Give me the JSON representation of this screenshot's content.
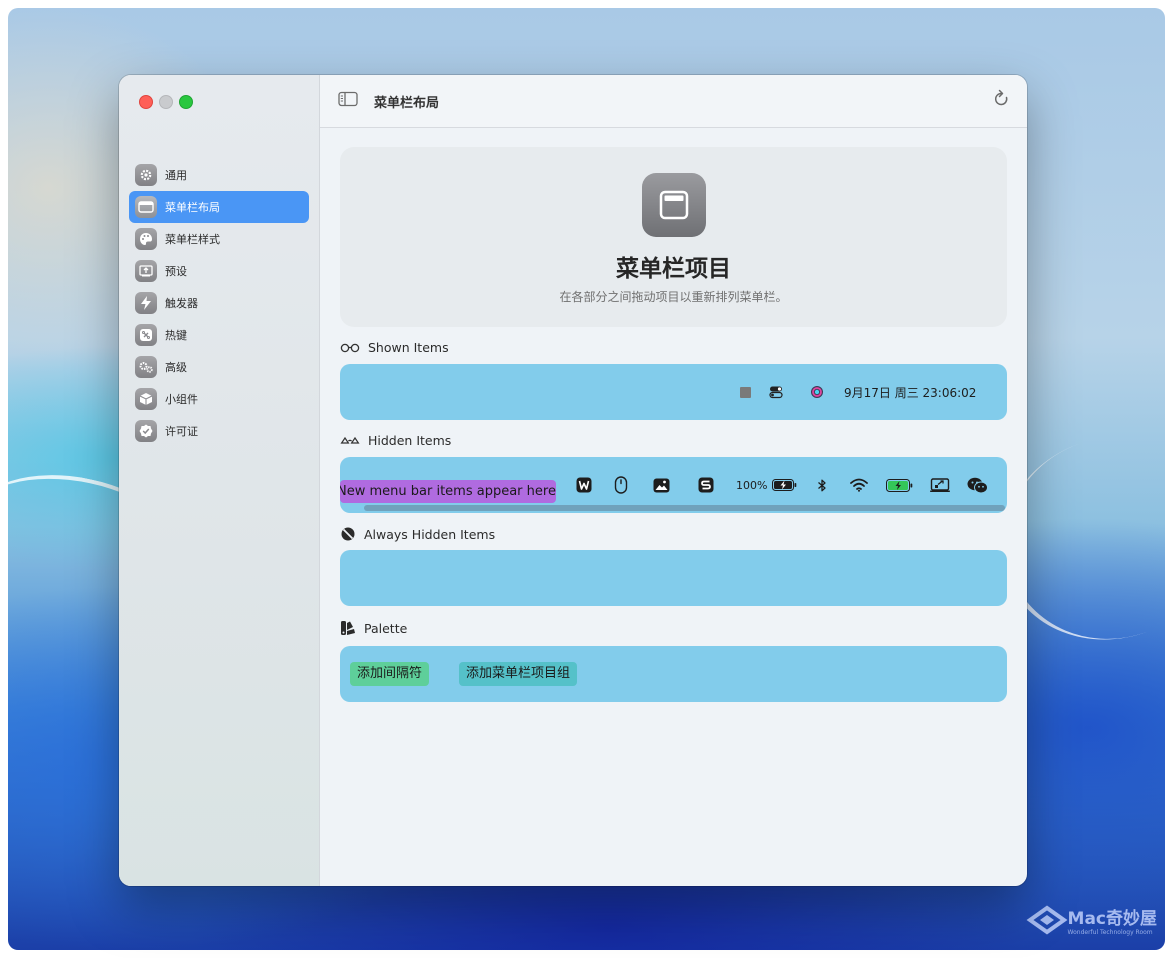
{
  "window": {
    "title": "菜单栏布局"
  },
  "sidebar": {
    "items": [
      {
        "label": "通用",
        "icon": "gear-icon"
      },
      {
        "label": "菜单栏布局",
        "icon": "menubar-layout-icon",
        "active": true
      },
      {
        "label": "菜单栏样式",
        "icon": "palette-icon"
      },
      {
        "label": "预设",
        "icon": "preset-icon"
      },
      {
        "label": "触发器",
        "icon": "bolt-icon"
      },
      {
        "label": "热键",
        "icon": "hotkey-icon"
      },
      {
        "label": "高级",
        "icon": "gears-icon"
      },
      {
        "label": "小组件",
        "icon": "cube-icon"
      },
      {
        "label": "许可证",
        "icon": "badge-check-icon"
      }
    ]
  },
  "hero": {
    "title": "菜单栏项目",
    "subtitle": "在各部分之间拖动项目以重新排列菜单栏。"
  },
  "sections": {
    "shown": {
      "label": "Shown Items",
      "clock": "9月17日 周三  23:06:02"
    },
    "hidden": {
      "label": "Hidden Items",
      "new_items_label": "New menu bar items appear here",
      "battery_percent": "100%"
    },
    "always_hidden": {
      "label": "Always Hidden Items"
    },
    "palette": {
      "label": "Palette",
      "add_spacer": "添加间隔符",
      "add_group": "添加菜单栏项目组"
    }
  },
  "watermark": {
    "text": "Mac奇妙屋",
    "sub": "Wonderful Technology Room"
  },
  "colors": {
    "accent": "#4a96f5",
    "bar_bg": "#82cceb",
    "new_items_pill": "#b06be0",
    "spacer_pill": "#5ecf9a",
    "group_pill": "#55c1c9"
  }
}
